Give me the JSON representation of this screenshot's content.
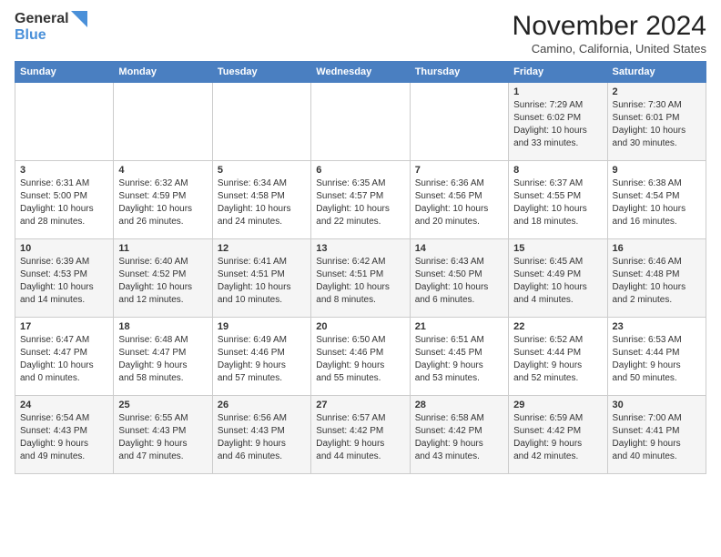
{
  "logo": {
    "line1": "General",
    "line2": "Blue"
  },
  "title": "November 2024",
  "subtitle": "Camino, California, United States",
  "days_of_week": [
    "Sunday",
    "Monday",
    "Tuesday",
    "Wednesday",
    "Thursday",
    "Friday",
    "Saturday"
  ],
  "weeks": [
    [
      {
        "day": "",
        "info": ""
      },
      {
        "day": "",
        "info": ""
      },
      {
        "day": "",
        "info": ""
      },
      {
        "day": "",
        "info": ""
      },
      {
        "day": "",
        "info": ""
      },
      {
        "day": "1",
        "info": "Sunrise: 7:29 AM\nSunset: 6:02 PM\nDaylight: 10 hours\nand 33 minutes."
      },
      {
        "day": "2",
        "info": "Sunrise: 7:30 AM\nSunset: 6:01 PM\nDaylight: 10 hours\nand 30 minutes."
      }
    ],
    [
      {
        "day": "3",
        "info": "Sunrise: 6:31 AM\nSunset: 5:00 PM\nDaylight: 10 hours\nand 28 minutes."
      },
      {
        "day": "4",
        "info": "Sunrise: 6:32 AM\nSunset: 4:59 PM\nDaylight: 10 hours\nand 26 minutes."
      },
      {
        "day": "5",
        "info": "Sunrise: 6:34 AM\nSunset: 4:58 PM\nDaylight: 10 hours\nand 24 minutes."
      },
      {
        "day": "6",
        "info": "Sunrise: 6:35 AM\nSunset: 4:57 PM\nDaylight: 10 hours\nand 22 minutes."
      },
      {
        "day": "7",
        "info": "Sunrise: 6:36 AM\nSunset: 4:56 PM\nDaylight: 10 hours\nand 20 minutes."
      },
      {
        "day": "8",
        "info": "Sunrise: 6:37 AM\nSunset: 4:55 PM\nDaylight: 10 hours\nand 18 minutes."
      },
      {
        "day": "9",
        "info": "Sunrise: 6:38 AM\nSunset: 4:54 PM\nDaylight: 10 hours\nand 16 minutes."
      }
    ],
    [
      {
        "day": "10",
        "info": "Sunrise: 6:39 AM\nSunset: 4:53 PM\nDaylight: 10 hours\nand 14 minutes."
      },
      {
        "day": "11",
        "info": "Sunrise: 6:40 AM\nSunset: 4:52 PM\nDaylight: 10 hours\nand 12 minutes."
      },
      {
        "day": "12",
        "info": "Sunrise: 6:41 AM\nSunset: 4:51 PM\nDaylight: 10 hours\nand 10 minutes."
      },
      {
        "day": "13",
        "info": "Sunrise: 6:42 AM\nSunset: 4:51 PM\nDaylight: 10 hours\nand 8 minutes."
      },
      {
        "day": "14",
        "info": "Sunrise: 6:43 AM\nSunset: 4:50 PM\nDaylight: 10 hours\nand 6 minutes."
      },
      {
        "day": "15",
        "info": "Sunrise: 6:45 AM\nSunset: 4:49 PM\nDaylight: 10 hours\nand 4 minutes."
      },
      {
        "day": "16",
        "info": "Sunrise: 6:46 AM\nSunset: 4:48 PM\nDaylight: 10 hours\nand 2 minutes."
      }
    ],
    [
      {
        "day": "17",
        "info": "Sunrise: 6:47 AM\nSunset: 4:47 PM\nDaylight: 10 hours\nand 0 minutes."
      },
      {
        "day": "18",
        "info": "Sunrise: 6:48 AM\nSunset: 4:47 PM\nDaylight: 9 hours\nand 58 minutes."
      },
      {
        "day": "19",
        "info": "Sunrise: 6:49 AM\nSunset: 4:46 PM\nDaylight: 9 hours\nand 57 minutes."
      },
      {
        "day": "20",
        "info": "Sunrise: 6:50 AM\nSunset: 4:46 PM\nDaylight: 9 hours\nand 55 minutes."
      },
      {
        "day": "21",
        "info": "Sunrise: 6:51 AM\nSunset: 4:45 PM\nDaylight: 9 hours\nand 53 minutes."
      },
      {
        "day": "22",
        "info": "Sunrise: 6:52 AM\nSunset: 4:44 PM\nDaylight: 9 hours\nand 52 minutes."
      },
      {
        "day": "23",
        "info": "Sunrise: 6:53 AM\nSunset: 4:44 PM\nDaylight: 9 hours\nand 50 minutes."
      }
    ],
    [
      {
        "day": "24",
        "info": "Sunrise: 6:54 AM\nSunset: 4:43 PM\nDaylight: 9 hours\nand 49 minutes."
      },
      {
        "day": "25",
        "info": "Sunrise: 6:55 AM\nSunset: 4:43 PM\nDaylight: 9 hours\nand 47 minutes."
      },
      {
        "day": "26",
        "info": "Sunrise: 6:56 AM\nSunset: 4:43 PM\nDaylight: 9 hours\nand 46 minutes."
      },
      {
        "day": "27",
        "info": "Sunrise: 6:57 AM\nSunset: 4:42 PM\nDaylight: 9 hours\nand 44 minutes."
      },
      {
        "day": "28",
        "info": "Sunrise: 6:58 AM\nSunset: 4:42 PM\nDaylight: 9 hours\nand 43 minutes."
      },
      {
        "day": "29",
        "info": "Sunrise: 6:59 AM\nSunset: 4:42 PM\nDaylight: 9 hours\nand 42 minutes."
      },
      {
        "day": "30",
        "info": "Sunrise: 7:00 AM\nSunset: 4:41 PM\nDaylight: 9 hours\nand 40 minutes."
      }
    ]
  ]
}
